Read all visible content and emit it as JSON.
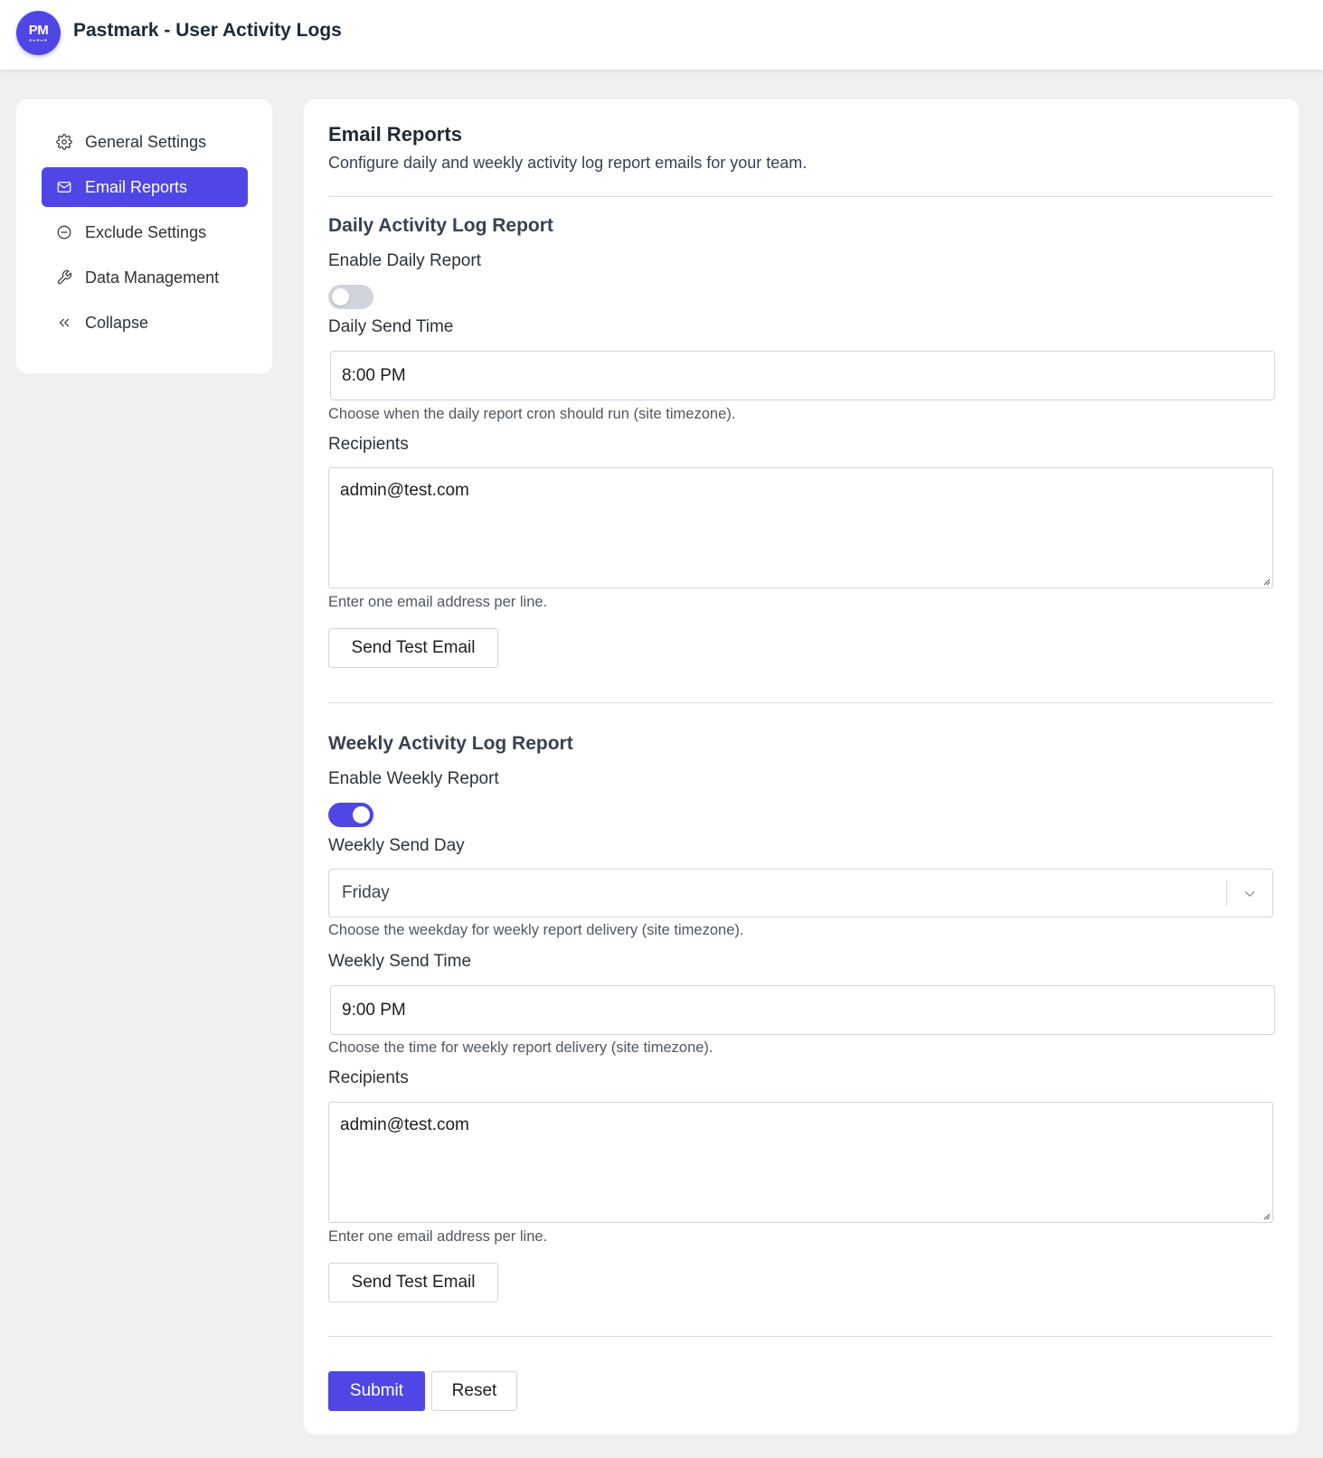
{
  "app": {
    "logo_text": "PM",
    "logo_dots": "•–•–•",
    "title": "Pastmark - User Activity Logs",
    "accent_color": "#4f46e5"
  },
  "sidebar": {
    "items": [
      {
        "label": "General Settings",
        "icon": "gear-icon",
        "active": false
      },
      {
        "label": "Email Reports",
        "icon": "mail-icon",
        "active": true
      },
      {
        "label": "Exclude Settings",
        "icon": "minus-circle-icon",
        "active": false
      },
      {
        "label": "Data Management",
        "icon": "wrench-icon",
        "active": false
      },
      {
        "label": "Collapse",
        "icon": "double-chevron-left-icon",
        "active": false
      }
    ]
  },
  "main": {
    "title": "Email Reports",
    "description": "Configure daily and weekly activity log report emails for your team.",
    "daily": {
      "section_title": "Daily Activity Log Report",
      "enable_label": "Enable Daily Report",
      "enabled": false,
      "send_time_label": "Daily Send Time",
      "send_time_value": "8:00 PM",
      "send_time_help": "Choose when the daily report cron should run (site timezone).",
      "recipients_label": "Recipients",
      "recipients_value": "admin@test.com",
      "recipients_help": "Enter one email address per line.",
      "test_button": "Send Test Email"
    },
    "weekly": {
      "section_title": "Weekly Activity Log Report",
      "enable_label": "Enable Weekly Report",
      "enabled": true,
      "send_day_label": "Weekly Send Day",
      "send_day_value": "Friday",
      "send_day_help": "Choose the weekday for weekly report delivery (site timezone).",
      "send_time_label": "Weekly Send Time",
      "send_time_value": "9:00 PM",
      "send_time_help": "Choose the time for weekly report delivery (site timezone).",
      "recipients_label": "Recipients",
      "recipients_value": "admin@test.com",
      "recipients_help": "Enter one email address per line.",
      "test_button": "Send Test Email"
    },
    "actions": {
      "submit": "Submit",
      "reset": "Reset"
    }
  }
}
